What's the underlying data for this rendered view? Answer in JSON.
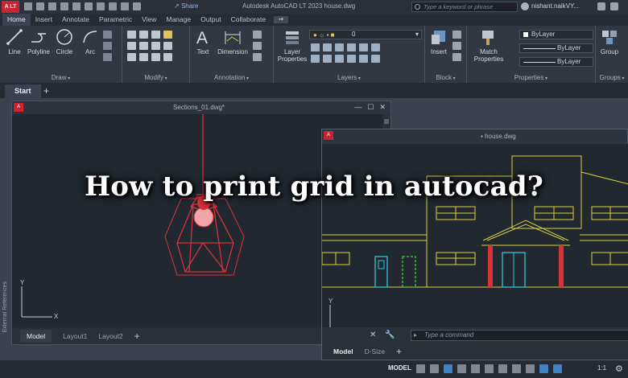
{
  "titlebar": {
    "app_logo": "A LT",
    "share_label": "Share",
    "title": "Autodesk AutoCAD LT 2023    house.dwg",
    "search_placeholder": "Type a keyword or phrase",
    "user": "nishant.naikVY..."
  },
  "ribbon_tabs": [
    "Home",
    "Insert",
    "Annotate",
    "Parametric",
    "View",
    "Manage",
    "Output",
    "Collaborate"
  ],
  "ribbon": {
    "draw": {
      "tools": [
        "Line",
        "Polyline",
        "Circle",
        "Arc"
      ],
      "label": "Draw"
    },
    "modify": {
      "label": "Modify"
    },
    "annotation": {
      "tools": [
        "Text",
        "Dimension"
      ],
      "label": "Annotation"
    },
    "layers": {
      "tool_line1": "Layer",
      "tool_line2": "Properties",
      "current_layer": "0",
      "label": "Layers"
    },
    "block": {
      "tool": "Insert",
      "label": "Block"
    },
    "properties": {
      "tool_line1": "Match",
      "tool_line2": "Properties",
      "color": "ByLayer",
      "linetype": "ByLayer",
      "lineweight": "ByLayer",
      "label": "Properties"
    },
    "groups": {
      "tool": "Group",
      "label": "Groups"
    }
  },
  "file_tabs": {
    "start": "Start",
    "add": "+"
  },
  "sidebar_label": "External References",
  "window1": {
    "title": "Sections_01.dwg*",
    "layouts": [
      "Model",
      "Layout1",
      "Layout2"
    ],
    "add": "+"
  },
  "window2": {
    "title": "house.dwg",
    "command_placeholder": "Type a command",
    "layouts": [
      "Model",
      "D-Size"
    ],
    "add": "+"
  },
  "statusbar": {
    "model": "MODEL",
    "scale": "1:1"
  },
  "headline": "How to print grid in autocad?",
  "colors": {
    "accent_red": "#c9242f",
    "drawing_red": "#d8313a",
    "drawing_yellow": "#d9d23a",
    "drawing_cyan": "#2fc6d8",
    "drawing_green": "#3bd43b"
  }
}
